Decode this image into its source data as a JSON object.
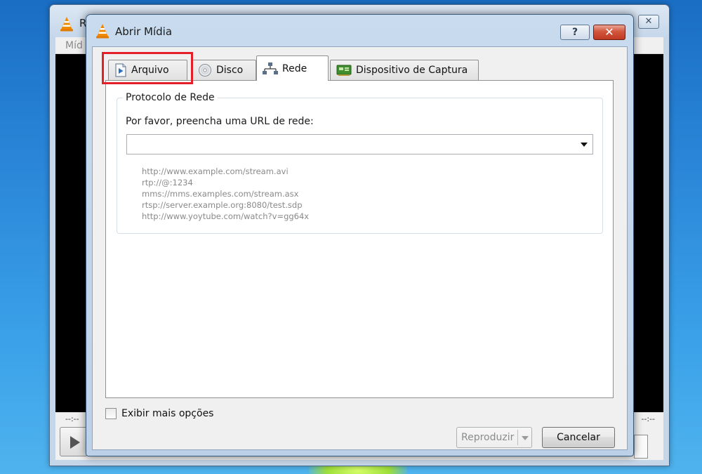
{
  "background_window": {
    "title_fragment": "R",
    "menu_fragment": "Míd",
    "close_glyph": "✕",
    "time_left": "--:--",
    "time_right": "--:--"
  },
  "dialog": {
    "title": "Abrir Mídia",
    "help_glyph": "?",
    "close_glyph": "✕",
    "tabs": [
      {
        "label": "Arquivo",
        "icon": "file-play-icon",
        "highlighted": true
      },
      {
        "label": "Disco",
        "icon": "disc-icon"
      },
      {
        "label": "Rede",
        "icon": "network-icon",
        "active": true
      },
      {
        "label": "Dispositivo de Captura",
        "icon": "capture-card-icon"
      }
    ],
    "group_title": "Protocolo de Rede",
    "url_label": "Por favor, preencha uma URL de rede:",
    "url_value": "",
    "examples": [
      "http://www.example.com/stream.avi",
      "rtp://@:1234",
      "mms://mms.examples.com/stream.asx",
      "rtsp://server.example.org:8080/test.sdp",
      "http://www.yoytube.com/watch?v=gg64x"
    ],
    "more_options_label": "Exibir mais opções",
    "more_options_checked": false,
    "play_label": "Reproduzir",
    "play_enabled": false,
    "cancel_label": "Cancelar"
  },
  "colors": {
    "highlight": "#e3202a",
    "close_button": "#c03a22",
    "vlc_orange": "#f08a00"
  }
}
